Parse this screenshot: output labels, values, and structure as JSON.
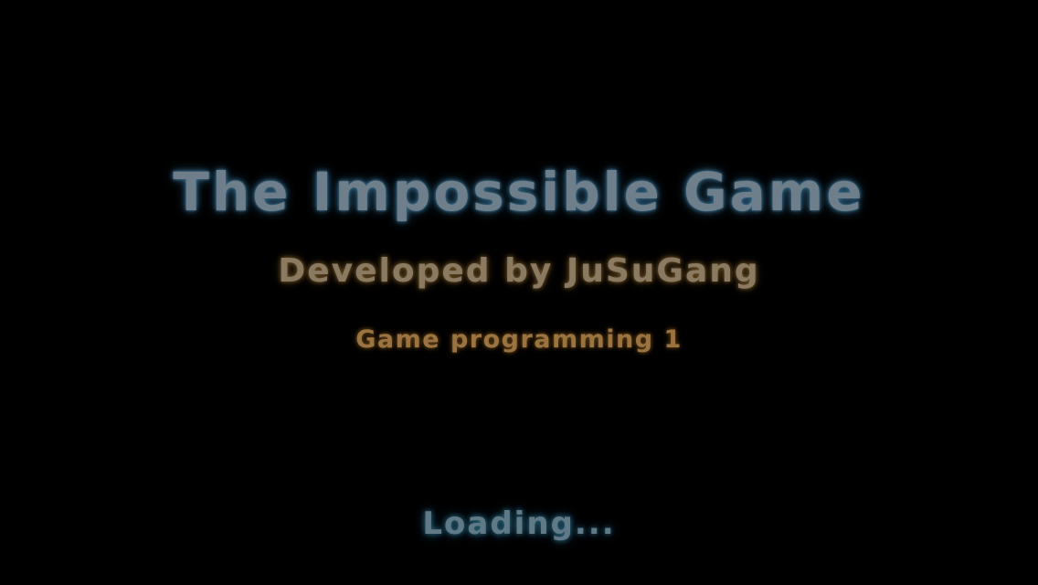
{
  "splash": {
    "title": "The Impossible Game",
    "developer": "Developed by JuSuGang",
    "course": "Game programming 1",
    "loading": "Loading..."
  },
  "colors": {
    "background": "#000000",
    "title": "#6e7f8b",
    "developer": "#8a7a62",
    "course": "#9a7340",
    "loading": "#5f7a86"
  }
}
